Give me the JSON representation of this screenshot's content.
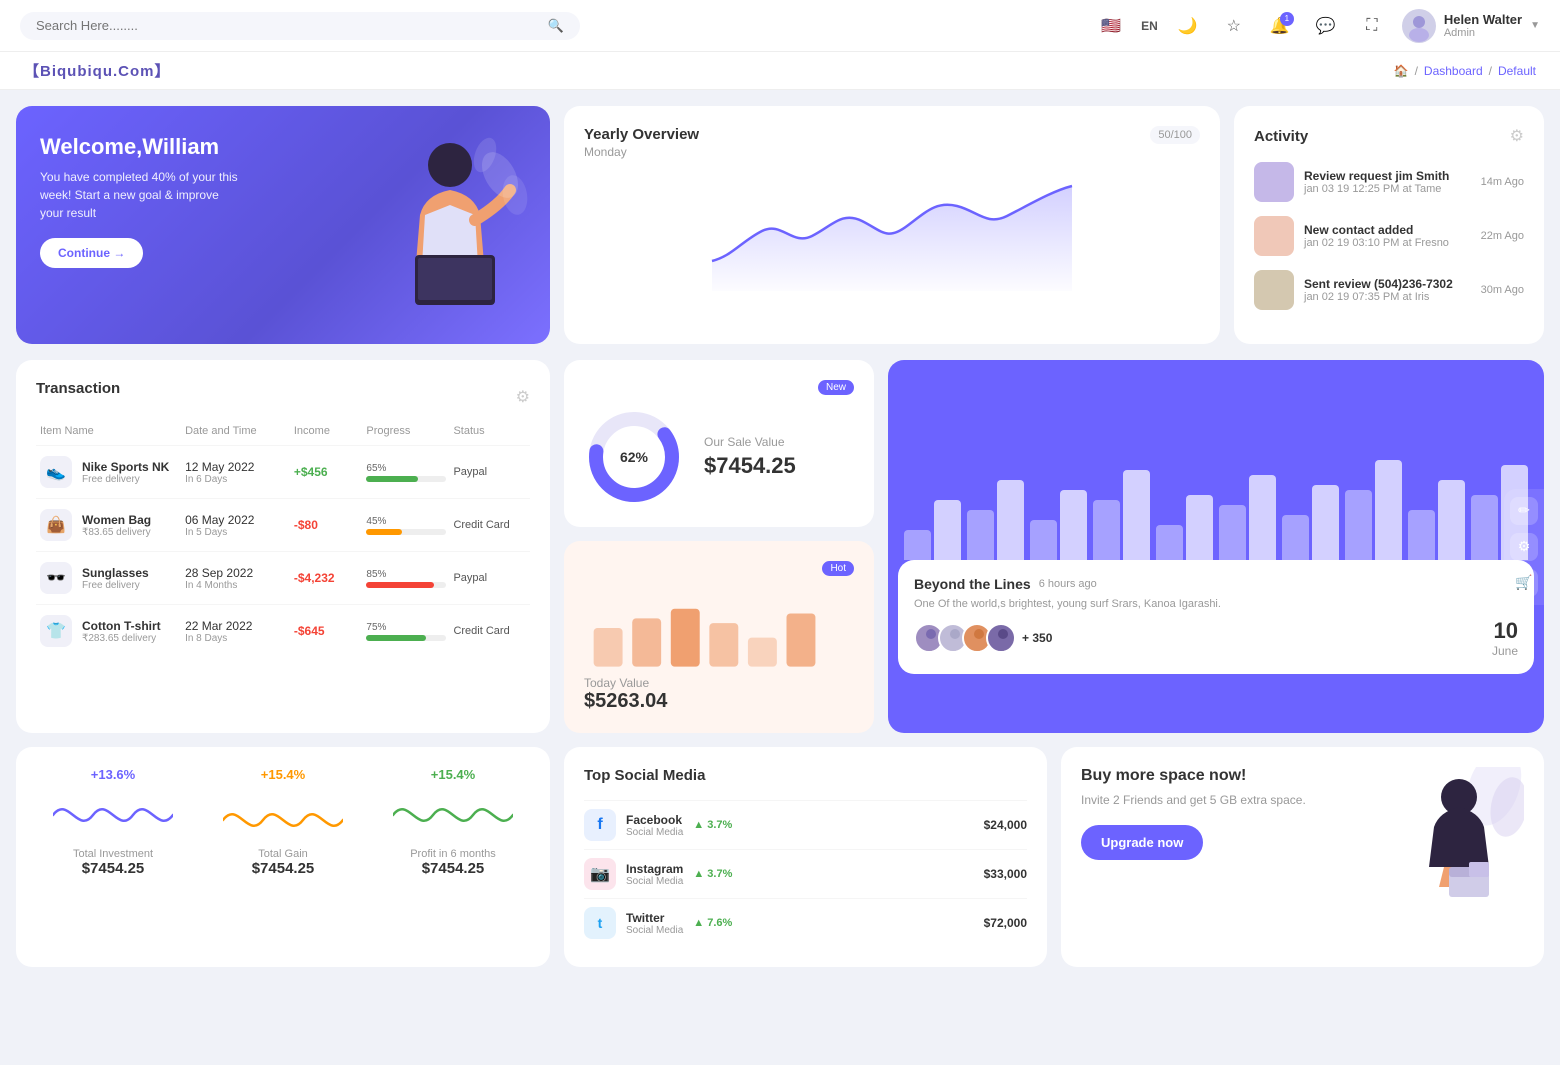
{
  "site": {
    "brand": "【Biqubiqu.Com】",
    "breadcrumb": [
      "Home",
      "Dashboard",
      "Default"
    ]
  },
  "nav": {
    "search_placeholder": "Search Here........",
    "lang": "EN",
    "user_name": "Helen Walter",
    "user_role": "Admin",
    "notification_count": "1"
  },
  "welcome": {
    "title": "Welcome,William",
    "description": "You have completed 40% of your this week! Start a new goal & improve your result",
    "button_label": "Continue →"
  },
  "yearly_overview": {
    "title": "Yearly Overview",
    "subtitle": "Monday",
    "badge": "50/100"
  },
  "activity": {
    "title": "Activity",
    "items": [
      {
        "title": "Review request jim Smith",
        "sub": "jan 03 19 12:25 PM at Tame",
        "time": "14m Ago"
      },
      {
        "title": "New contact added",
        "sub": "jan 02 19 03:10 PM at Fresno",
        "time": "22m Ago"
      },
      {
        "title": "Sent review (504)236-7302",
        "sub": "jan 02 19 07:35 PM at Iris",
        "time": "30m Ago"
      }
    ]
  },
  "transaction": {
    "title": "Transaction",
    "columns": [
      "Item Name",
      "Date and Time",
      "Income",
      "Progress",
      "Status"
    ],
    "rows": [
      {
        "name": "Nike Sports NK",
        "sub": "Free delivery",
        "icon": "👟",
        "date": "12 May 2022",
        "date_sub": "In 6 Days",
        "income": "+$456",
        "income_type": "pos",
        "progress": 65,
        "progress_color": "#4caf50",
        "status": "Paypal"
      },
      {
        "name": "Women Bag",
        "sub": "₹83.65 delivery",
        "icon": "👜",
        "date": "06 May 2022",
        "date_sub": "In 5 Days",
        "income": "-$80",
        "income_type": "neg",
        "progress": 45,
        "progress_color": "#ff9800",
        "status": "Credit Card"
      },
      {
        "name": "Sunglasses",
        "sub": "Free delivery",
        "icon": "🕶️",
        "date": "28 Sep 2022",
        "date_sub": "In 4 Months",
        "income": "-$4,232",
        "income_type": "neg",
        "progress": 85,
        "progress_color": "#f44336",
        "status": "Paypal"
      },
      {
        "name": "Cotton T-shirt",
        "sub": "₹283.65 delivery",
        "icon": "👕",
        "date": "22 Mar 2022",
        "date_sub": "In 8 Days",
        "income": "-$645",
        "income_type": "neg",
        "progress": 75,
        "progress_color": "#4caf50",
        "status": "Credit Card"
      }
    ]
  },
  "sale_value": {
    "badge": "New",
    "percentage": "62%",
    "label": "Our Sale Value",
    "value": "$7454.25"
  },
  "today_value": {
    "badge": "Hot",
    "label": "Today Value",
    "value": "$5263.04"
  },
  "beyond": {
    "title": "Beyond the Lines",
    "time": "6 hours ago",
    "description": "One Of the world,s brightest, young surf Srars, Kanoa Igarashi.",
    "plus_count": "+ 350",
    "date_num": "10",
    "date_month": "June"
  },
  "mini_stats": [
    {
      "percent": "+13.6%",
      "percent_color": "#6c63ff",
      "label": "Total Investment",
      "value": "$7454.25",
      "wave_color": "#6c63ff"
    },
    {
      "percent": "+15.4%",
      "percent_color": "#ff9800",
      "label": "Total Gain",
      "value": "$7454.25",
      "wave_color": "#ff9800"
    },
    {
      "percent": "+15.4%",
      "percent_color": "#4caf50",
      "label": "Profit in 6 months",
      "value": "$7454.25",
      "wave_color": "#4caf50"
    }
  ],
  "social_media": {
    "title": "Top Social Media",
    "items": [
      {
        "name": "Facebook",
        "sub": "Social Media",
        "icon": "f",
        "icon_bg": "#e8f0fe",
        "icon_color": "#1877f2",
        "change": "3.7%",
        "value": "$24,000"
      },
      {
        "name": "Instagram",
        "sub": "Social Media",
        "icon": "📷",
        "icon_bg": "#fce4ec",
        "icon_color": "#e91e63",
        "change": "3.7%",
        "value": "$33,000"
      },
      {
        "name": "Twitter",
        "sub": "Social Media",
        "icon": "t",
        "icon_bg": "#e3f2fd",
        "icon_color": "#1da1f2",
        "change": "7.6%",
        "value": "$72,000"
      }
    ]
  },
  "buy_space": {
    "title": "Buy more space now!",
    "description": "Invite 2 Friends and get 5 GB extra space.",
    "button_label": "Upgrade now"
  },
  "bar_chart": {
    "bars": [
      [
        30,
        60
      ],
      [
        50,
        80
      ],
      [
        40,
        70
      ],
      [
        60,
        90
      ],
      [
        35,
        65
      ],
      [
        55,
        85
      ],
      [
        45,
        75
      ],
      [
        70,
        100
      ],
      [
        50,
        80
      ],
      [
        65,
        95
      ]
    ]
  }
}
